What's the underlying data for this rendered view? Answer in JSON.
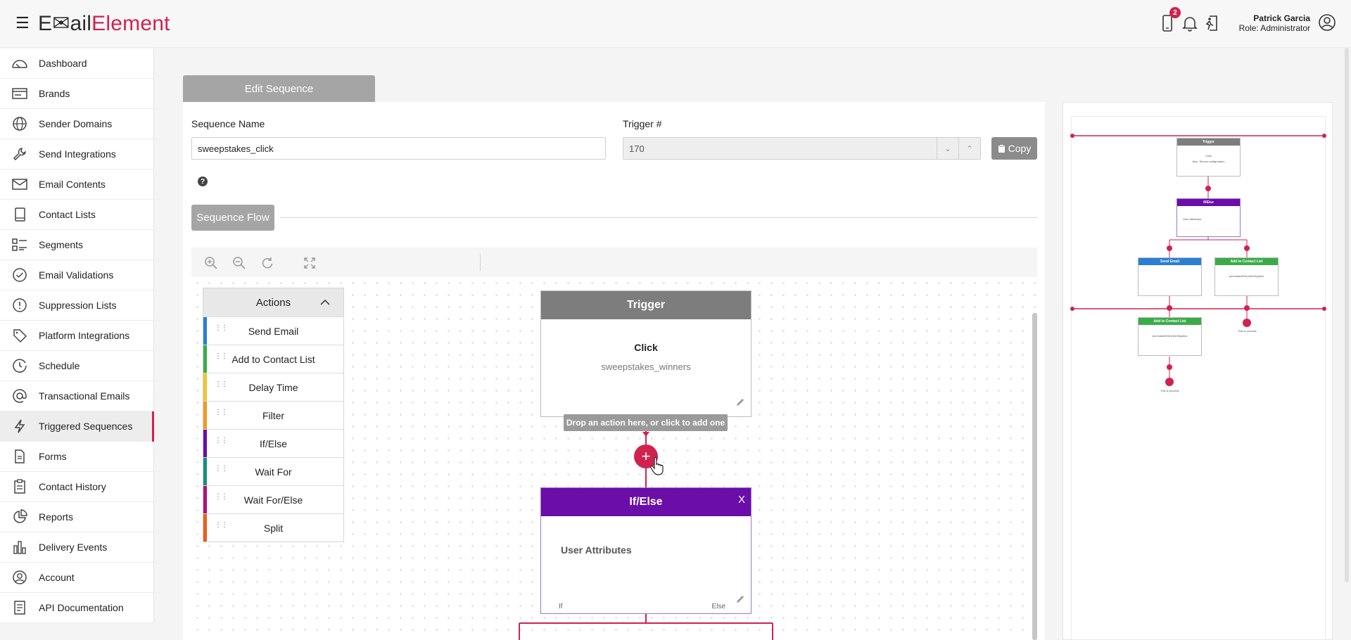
{
  "app": {
    "logo_part1": "E✉ail",
    "logo_part2": "Element",
    "notification_count": "2",
    "user_name": "Patrick Garcia",
    "user_role": "Role: Administrator",
    "brand_color": "#d1224f"
  },
  "sidebar": {
    "items": [
      {
        "label": "Dashboard",
        "icon": "gauge-icon"
      },
      {
        "label": "Brands",
        "icon": "card-icon"
      },
      {
        "label": "Sender Domains",
        "icon": "globe-icon"
      },
      {
        "label": "Send Integrations",
        "icon": "wrench-icon"
      },
      {
        "label": "Email Contents",
        "icon": "envelope-icon"
      },
      {
        "label": "Contact Lists",
        "icon": "book-icon"
      },
      {
        "label": "Segments",
        "icon": "segments-icon"
      },
      {
        "label": "Email Validations",
        "icon": "check-circle-icon"
      },
      {
        "label": "Suppression Lists",
        "icon": "alert-circle-icon"
      },
      {
        "label": "Platform Integrations",
        "icon": "tag-icon"
      },
      {
        "label": "Schedule",
        "icon": "clock-icon"
      },
      {
        "label": "Transactional Emails",
        "icon": "at-icon"
      },
      {
        "label": "Triggered Sequences",
        "icon": "lightning-icon",
        "active": true
      },
      {
        "label": "Forms",
        "icon": "document-icon"
      },
      {
        "label": "Contact History",
        "icon": "clipboard-icon"
      },
      {
        "label": "Reports",
        "icon": "pie-icon"
      },
      {
        "label": "Delivery Events",
        "icon": "bars-icon"
      },
      {
        "label": "Account",
        "icon": "user-circle-icon"
      },
      {
        "label": "API Documentation",
        "icon": "api-doc-icon"
      }
    ]
  },
  "editor": {
    "tab_label": "Edit Sequence",
    "sequence_name_label": "Sequence Name",
    "sequence_name_value": "sweepstakes_click",
    "trigger_label": "Trigger #",
    "trigger_value": "170",
    "copy_label": "Copy",
    "help_glyph": "?",
    "flow_label": "Sequence Flow"
  },
  "actions_panel": {
    "title": "Actions",
    "items": [
      {
        "label": "Send Email",
        "color": "#2a7fd4"
      },
      {
        "label": "Add to Contact List",
        "color": "#3bab4a"
      },
      {
        "label": "Delay Time",
        "color": "#f1c232"
      },
      {
        "label": "Filter",
        "color": "#f39a1e"
      },
      {
        "label": "If/Else",
        "color": "#6a0dad"
      },
      {
        "label": "Wait For",
        "color": "#16907a"
      },
      {
        "label": "Wait For/Else",
        "color": "#b0117c"
      },
      {
        "label": "Split",
        "color": "#e8601c"
      }
    ]
  },
  "flow": {
    "trigger_node": {
      "title": "Trigger",
      "event": "Click",
      "detail": "sweepstakes_winners",
      "color": "#7d7d7d"
    },
    "drop_hint": "Drop an action here, or click to add one",
    "ifelse_node": {
      "title": "If/Else",
      "body": "User Attributes",
      "if_label": "If",
      "else_label": "Else",
      "close": "X",
      "color": "#6a0da9"
    }
  },
  "minimap": {
    "trigger": {
      "title": "Trigger",
      "line1": "Click",
      "line2": "Also, Shows configuration"
    },
    "ifelse": {
      "title": "If/Else",
      "body": "User Attributes"
    },
    "send_email": {
      "title": "Send Email"
    },
    "add_contact_1": {
      "title": "Add to Contact List",
      "body": "purchasedEntryIntoSegAlso"
    },
    "add_contact_2": {
      "title": "Add to Contact List",
      "body": "purchasedEntryIntoSegAlso"
    },
    "end_label": "This is process"
  }
}
